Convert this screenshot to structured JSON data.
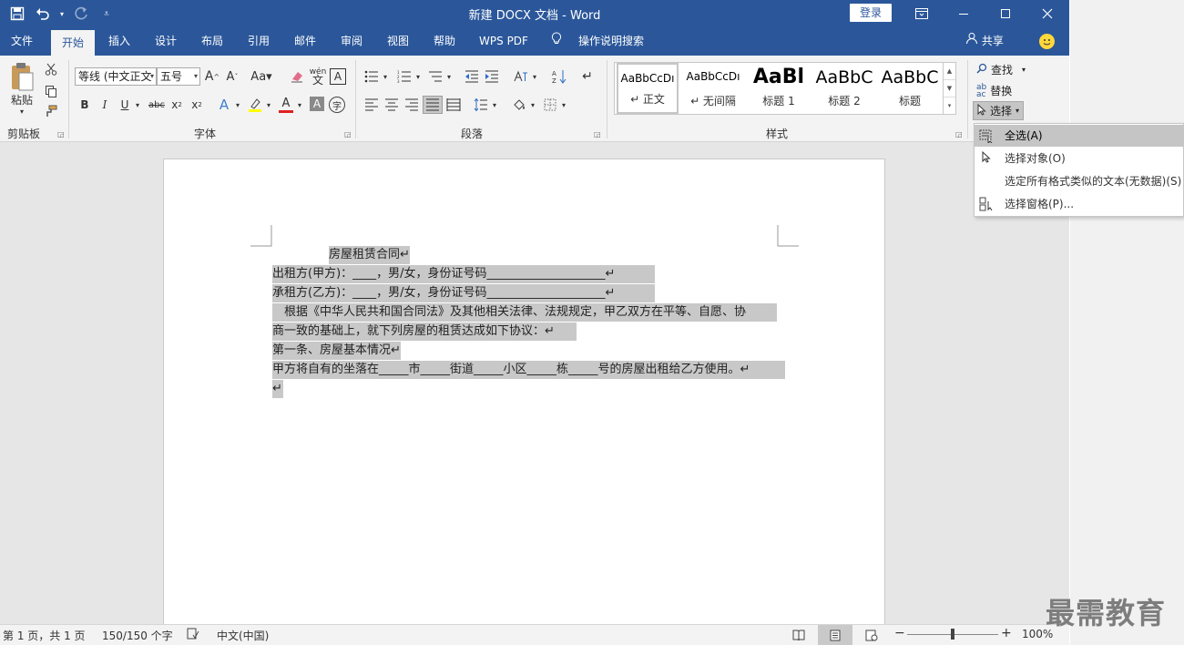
{
  "titlebar": {
    "title": "新建 DOCX 文档 - Word",
    "login": "登录",
    "qat": {
      "save_icon": "save-icon",
      "undo_icon": "undo-icon",
      "redo_icon": "redo-icon",
      "customize_icon": "customize-icon"
    }
  },
  "tabs": [
    "文件",
    "开始",
    "插入",
    "设计",
    "布局",
    "引用",
    "邮件",
    "审阅",
    "视图",
    "帮助",
    "WPS PDF",
    "操作说明搜索"
  ],
  "share": "共享",
  "ribbon": {
    "clipboard": {
      "paste": "粘贴",
      "label": "剪贴板"
    },
    "font": {
      "font_name": "等线 (中文正文",
      "font_size": "五号",
      "label": "字体",
      "wen": "wén"
    },
    "paragraph": {
      "label": "段落"
    },
    "styles": {
      "label": "样式",
      "items": [
        {
          "preview": "AaBbCcDı",
          "name": "↵ 正文"
        },
        {
          "preview": "AaBbCcDı",
          "name": "↵ 无间隔"
        },
        {
          "preview": "AaBl",
          "name": "标题 1"
        },
        {
          "preview": "AaBbC",
          "name": "标题 2"
        },
        {
          "preview": "AaBbC",
          "name": "标题"
        }
      ]
    },
    "editing": {
      "find": "查找",
      "replace": "替换",
      "select": "选择"
    }
  },
  "dropdown": {
    "items": [
      {
        "label": "全选(A)"
      },
      {
        "label": "选择对象(O)"
      },
      {
        "label": "选定所有格式类似的文本(无数据)(S)"
      },
      {
        "label": "选择窗格(P)..."
      }
    ]
  },
  "document": {
    "lines": [
      "房屋租赁合同↵",
      "出租方(甲方)：____，男/女，身份证号码____________________↵",
      "承租方(乙方)：____，男/女，身份证号码____________________↵",
      "　根据《中华人民共和国合同法》及其他相关法律、法规规定，甲乙双方在平等、自愿、协",
      "商一致的基础上，就下列房屋的租赁达成如下协议：↵",
      "第一条、房屋基本情况↵",
      "甲方将自有的坐落在_____市_____街道_____小区_____栋_____号的房屋出租给乙方使用。↵",
      "↵"
    ]
  },
  "statusbar": {
    "page": "第 1 页，共 1 页",
    "words": "150/150 个字",
    "lang": "中文(中国)",
    "zoom": "100%",
    "zoom_level": 100
  },
  "watermark": "最需教育",
  "colors": {
    "accent": "#2b579a",
    "selection": "#c8c8c8"
  }
}
